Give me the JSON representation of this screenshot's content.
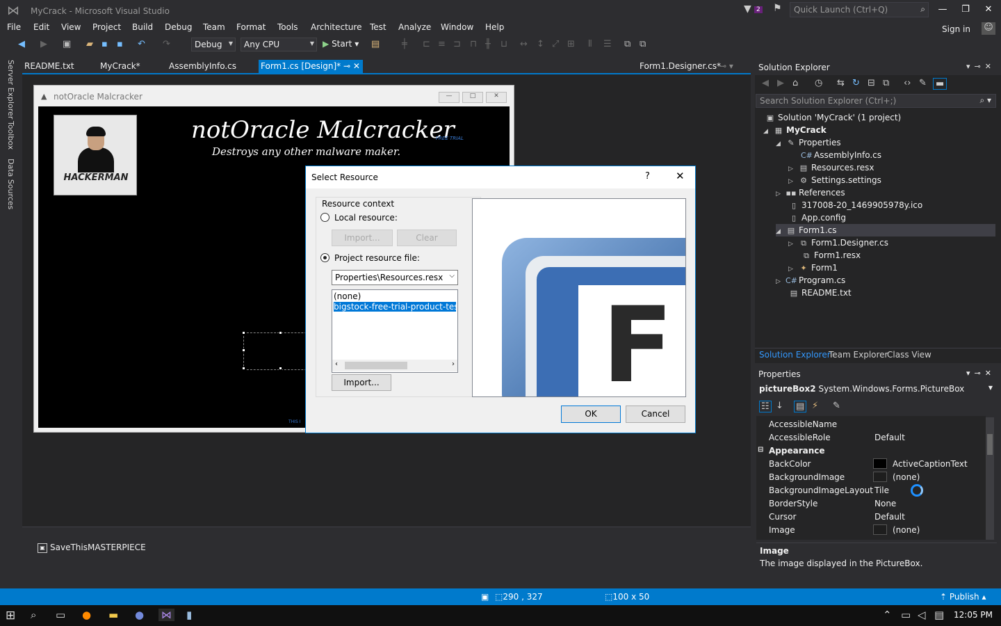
{
  "app": {
    "title": "MyCrack - Microsoft Visual Studio"
  },
  "titlebar": {
    "notification_count": "2",
    "quick_launch_placeholder": "Quick Launch (Ctrl+Q)"
  },
  "menu": [
    "File",
    "Edit",
    "View",
    "Project",
    "Build",
    "Debug",
    "Team",
    "Format",
    "Tools",
    "Architecture",
    "Test",
    "Analyze",
    "Window",
    "Help"
  ],
  "account": {
    "signin": "Sign in"
  },
  "toolbar": {
    "config": "Debug",
    "platform": "Any CPU",
    "start": "Start"
  },
  "left_rail": [
    "Server Explorer",
    "Toolbox",
    "Data Sources"
  ],
  "doc_tabs": [
    "README.txt",
    "MyCrack*",
    "AssemblyInfo.cs",
    "Form1.cs [Design]*",
    "Form1.Designer.cs*"
  ],
  "form": {
    "window_title": "notOracle Malcracker",
    "big_title": "notOracle Malcracker",
    "free_trial": "FREE TRIAL",
    "subtitle": "Destroys any other malware maker.",
    "picture_caption": "HACKERMAN",
    "bottom_text": "THIS I"
  },
  "tray": {
    "component": "SaveThisMASTERPIECE"
  },
  "dialog": {
    "title": "Select Resource",
    "help": "?",
    "context_label": "Resource context",
    "local_label": "Local resource:",
    "import_disabled": "Import...",
    "clear": "Clear",
    "project_label": "Project resource file:",
    "resource_file": "Properties\\Resources.resx",
    "list": [
      "(none)",
      "bigstock-free-trial-product-test-s"
    ],
    "import": "Import...",
    "preview_letter": "F",
    "ok": "OK",
    "cancel": "Cancel"
  },
  "solution_explorer": {
    "title": "Solution Explorer",
    "search_placeholder": "Search Solution Explorer (Ctrl+;)",
    "nodes": [
      {
        "label": "Solution 'MyCrack' (1 project)",
        "icon": "solution-icon"
      },
      {
        "label": "MyCrack",
        "icon": "csharp-project-icon"
      },
      {
        "label": "Properties",
        "icon": "wrench-icon"
      },
      {
        "label": "AssemblyInfo.cs",
        "icon": "cs-file-icon"
      },
      {
        "label": "Resources.resx",
        "icon": "resx-icon"
      },
      {
        "label": "Settings.settings",
        "icon": "gear-icon"
      },
      {
        "label": "References",
        "icon": "references-icon"
      },
      {
        "label": "317008-20_1469905978y.ico",
        "icon": "ico-file-icon"
      },
      {
        "label": "App.config",
        "icon": "config-icon"
      },
      {
        "label": "Form1.cs",
        "icon": "form-icon"
      },
      {
        "label": "Form1.Designer.cs",
        "icon": "designer-icon"
      },
      {
        "label": "Form1.resx",
        "icon": "resx-icon"
      },
      {
        "label": "Form1",
        "icon": "class-icon"
      },
      {
        "label": "Program.cs",
        "icon": "cs-file-icon"
      },
      {
        "label": "README.txt",
        "icon": "text-file-icon"
      }
    ],
    "tabs": [
      "Solution Explorer",
      "Team Explorer",
      "Class View"
    ]
  },
  "properties": {
    "title": "Properties",
    "object_name": "pictureBox2",
    "object_type": "System.Windows.Forms.PictureBox",
    "rows": [
      {
        "name": "AccessibleName",
        "value": ""
      },
      {
        "name": "AccessibleRole",
        "value": "Default"
      },
      {
        "name": "Appearance",
        "value": "",
        "category": true
      },
      {
        "name": "BackColor",
        "value": "ActiveCaptionText",
        "swatch": "#000000"
      },
      {
        "name": "BackgroundImage",
        "value": "(none)",
        "swatch": "#1e1e1e"
      },
      {
        "name": "BackgroundImageLayout",
        "value": "Tile"
      },
      {
        "name": "BorderStyle",
        "value": "None"
      },
      {
        "name": "Cursor",
        "value": "Default"
      },
      {
        "name": "Image",
        "value": "(none)",
        "swatch": "#1e1e1e"
      }
    ],
    "desc_title": "Image",
    "desc_text": "The image displayed in the PictureBox."
  },
  "status": {
    "position": "290 , 327",
    "size": "100 x 50",
    "publish": "Publish"
  },
  "taskbar": {
    "time": "12:05 PM"
  },
  "colors": {
    "accent": "#007acc",
    "background": "#2d2d30",
    "panel": "#252526"
  }
}
